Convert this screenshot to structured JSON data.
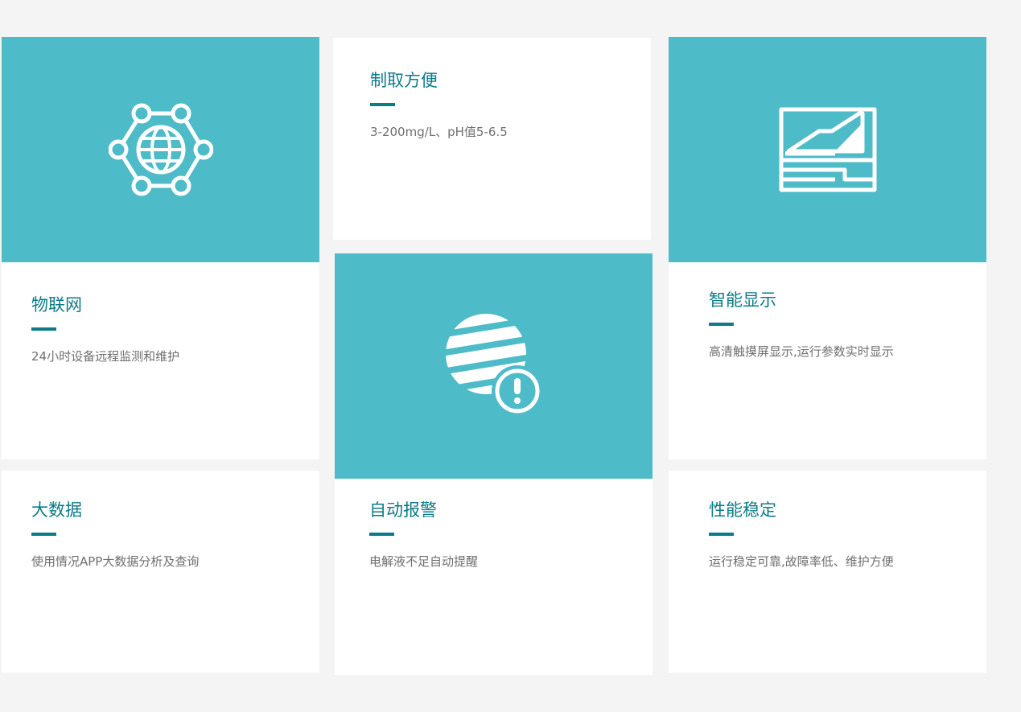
{
  "features": {
    "iot": {
      "title": "物联网",
      "desc": "24小时设备远程监测和维护",
      "icon": "iot-network-globe-icon"
    },
    "prep": {
      "title": "制取方便",
      "desc": "3-200mg/L、pH值5-6.5"
    },
    "display": {
      "title": "智能显示",
      "desc": "高清触摸屏显示,运行参数实时显示",
      "icon": "touchscreen-chart-icon"
    },
    "bigdata": {
      "title": "大数据",
      "desc": "使用情况APP大数据分析及查询"
    },
    "alarm": {
      "title": "自动报警",
      "desc": "电解液不足自动提醒",
      "icon": "globe-alert-icon"
    },
    "stable": {
      "title": "性能稳定",
      "desc": "运行稳定可靠,故障率低、维护方便"
    }
  },
  "colors": {
    "accent": "#0b7b88",
    "tile": "#4ebbc9",
    "background": "#f4f4f4"
  }
}
